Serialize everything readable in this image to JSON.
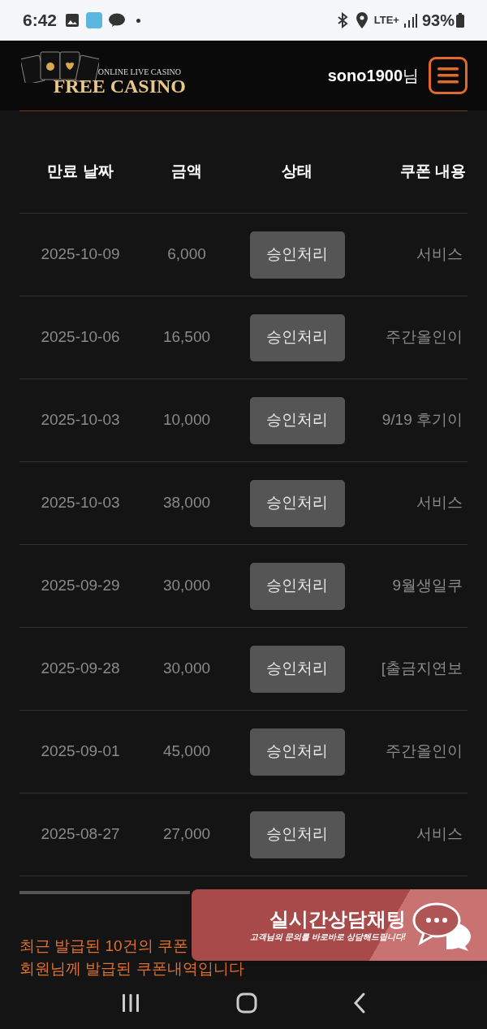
{
  "status_bar": {
    "time": "6:42",
    "battery": "93%",
    "network": "LTE+"
  },
  "header": {
    "logo_tagline": "ONLINE LIVE CASINO",
    "logo_name": "FREE CASINO",
    "username": "sono1900",
    "suffix": "님"
  },
  "table": {
    "columns": [
      "만료 날짜",
      "금액",
      "상태",
      "쿠폰 내용"
    ],
    "rows": [
      {
        "date": "2025-10-09",
        "amount": "6,000",
        "status": "승인처리",
        "content": "서비스"
      },
      {
        "date": "2025-10-06",
        "amount": "16,500",
        "status": "승인처리",
        "content": "주간올인이"
      },
      {
        "date": "2025-10-03",
        "amount": "10,000",
        "status": "승인처리",
        "content": "9/19 후기이"
      },
      {
        "date": "2025-10-03",
        "amount": "38,000",
        "status": "승인처리",
        "content": "서비스"
      },
      {
        "date": "2025-09-29",
        "amount": "30,000",
        "status": "승인처리",
        "content": "9월생일쿠"
      },
      {
        "date": "2025-09-28",
        "amount": "30,000",
        "status": "승인처리",
        "content": "[출금지연보"
      },
      {
        "date": "2025-09-01",
        "amount": "45,000",
        "status": "승인처리",
        "content": "주간올인이"
      },
      {
        "date": "2025-08-27",
        "amount": "27,000",
        "status": "승인처리",
        "content": "서비스"
      }
    ]
  },
  "notes": [
    "최근 발급된 10건의 쿠폰",
    "회원님께 발급된 쿠폰내역입니다"
  ],
  "chat_banner": {
    "title": "실시간상담채팅",
    "subtitle": "고객님의 문의를 바로바로 상담해드립니다!"
  }
}
